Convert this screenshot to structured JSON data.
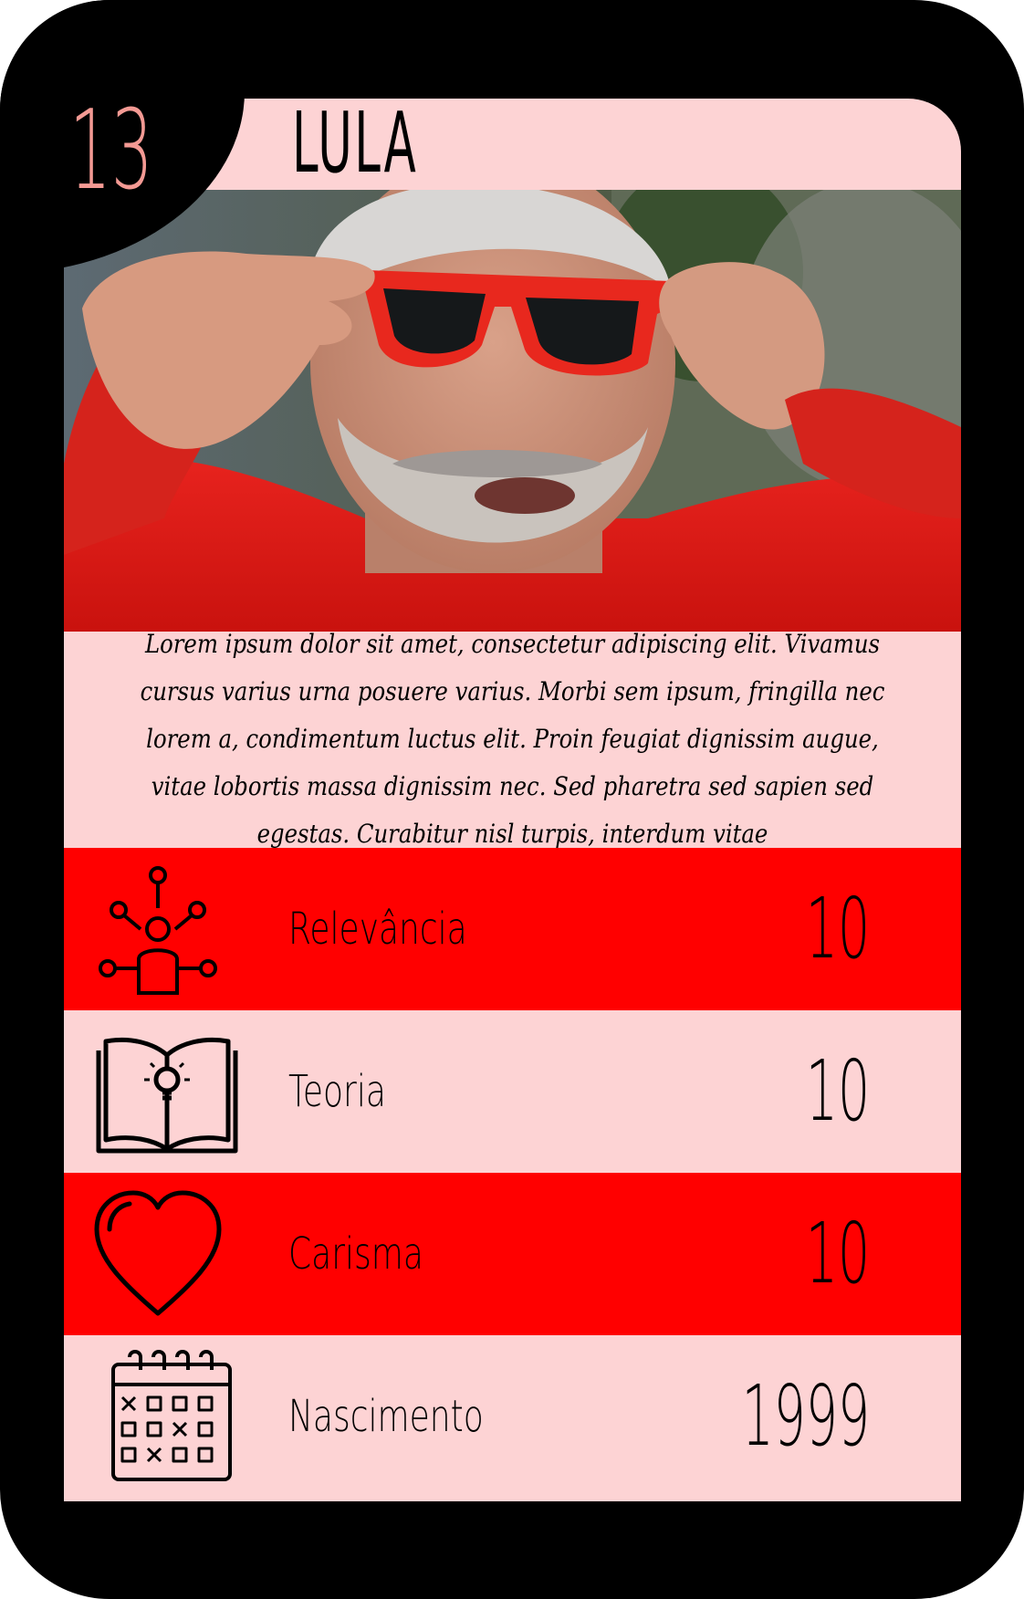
{
  "card": {
    "number": "13",
    "name": "LULA",
    "description": "Lorem ipsum dolor sit amet, consectetur adipiscing elit. Vivamus cursus varius urna posuere varius. Morbi sem ipsum, fringilla nec lorem a, condimentum luctus elit. Proin feugiat dignissim augue, vitae lobortis massa dignissim nec. Sed pharetra sed sapien sed egestas. Curabitur nisl turpis, interdum vitae",
    "colors": {
      "frame": "#000000",
      "panel": "#fdd3d4",
      "accent_red": "#ff0000",
      "number": "#f49a94"
    }
  },
  "photo": {
    "subject": "portrait of Lula adjusting red sunglasses, wearing a red shirt"
  },
  "stats": [
    {
      "label": "Relevância",
      "value": "10",
      "icon": "network-person-icon",
      "row_color": "red"
    },
    {
      "label": "Teoria",
      "value": "10",
      "icon": "book-lightbulb-icon",
      "row_color": "pink"
    },
    {
      "label": "Carisma",
      "value": "10",
      "icon": "heart-icon",
      "row_color": "red"
    },
    {
      "label": "Nascimento",
      "value": "1999",
      "icon": "calendar-icon",
      "row_color": "pink"
    }
  ]
}
